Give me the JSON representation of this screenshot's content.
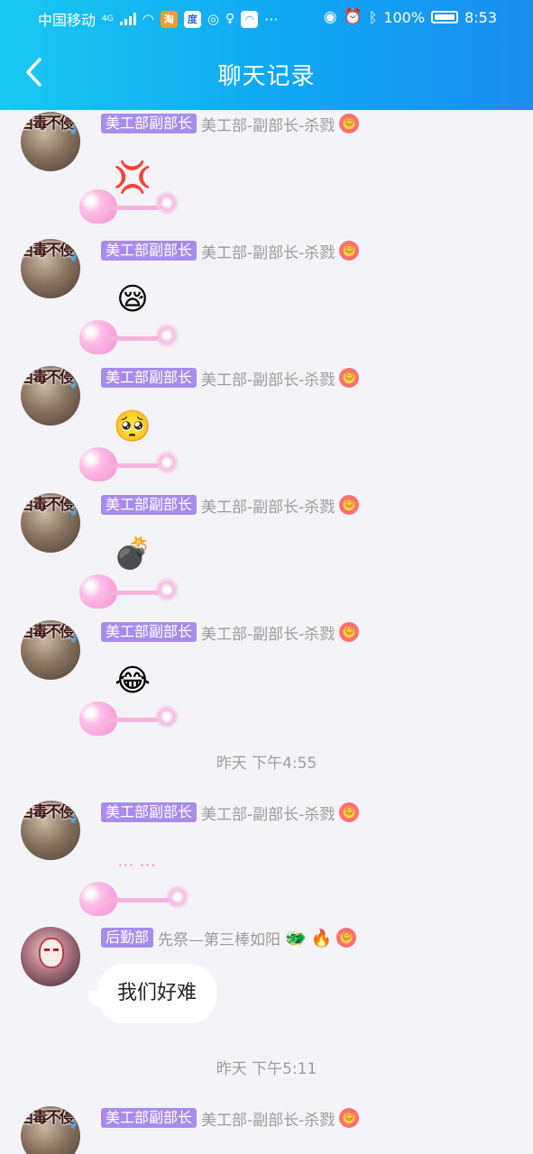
{
  "status_bar": {
    "carrier": "中国移动",
    "network": "4G",
    "battery": "100%",
    "time": "8:53"
  },
  "header": {
    "title": "聊天记录"
  },
  "messages": [
    {
      "badge": "美工部副部长",
      "nickname": "美工部-副部长-杀戮",
      "avatar_text": "百毒不侵",
      "content": "💢"
    },
    {
      "badge": "美工部副部长",
      "nickname": "美工部-副部长-杀戮",
      "avatar_text": "百毒不侵",
      "content": "😪"
    },
    {
      "badge": "美工部副部长",
      "nickname": "美工部-副部长-杀戮",
      "avatar_text": "百毒不侵",
      "content": "🥺"
    },
    {
      "badge": "美工部副部长",
      "nickname": "美工部-副部长-杀戮",
      "avatar_text": "百毒不侵",
      "content": "💣"
    },
    {
      "badge": "美工部副部长",
      "nickname": "美工部-副部长-杀戮",
      "avatar_text": "百毒不侵",
      "content": "😂"
    },
    {
      "badge": "美工部副部长",
      "nickname": "美工部-副部长-杀戮",
      "avatar_text": "百毒不侵",
      "content": "···  ···"
    },
    {
      "badge": "后勤部",
      "nickname": "先祭—第三棒如阳",
      "content": "我们好难"
    },
    {
      "badge": "美工部副部长",
      "nickname": "美工部-副部长-杀戮",
      "avatar_text": "百毒不侵"
    }
  ],
  "timestamps": [
    "昨天 下午4:55",
    "昨天 下午5:11"
  ]
}
